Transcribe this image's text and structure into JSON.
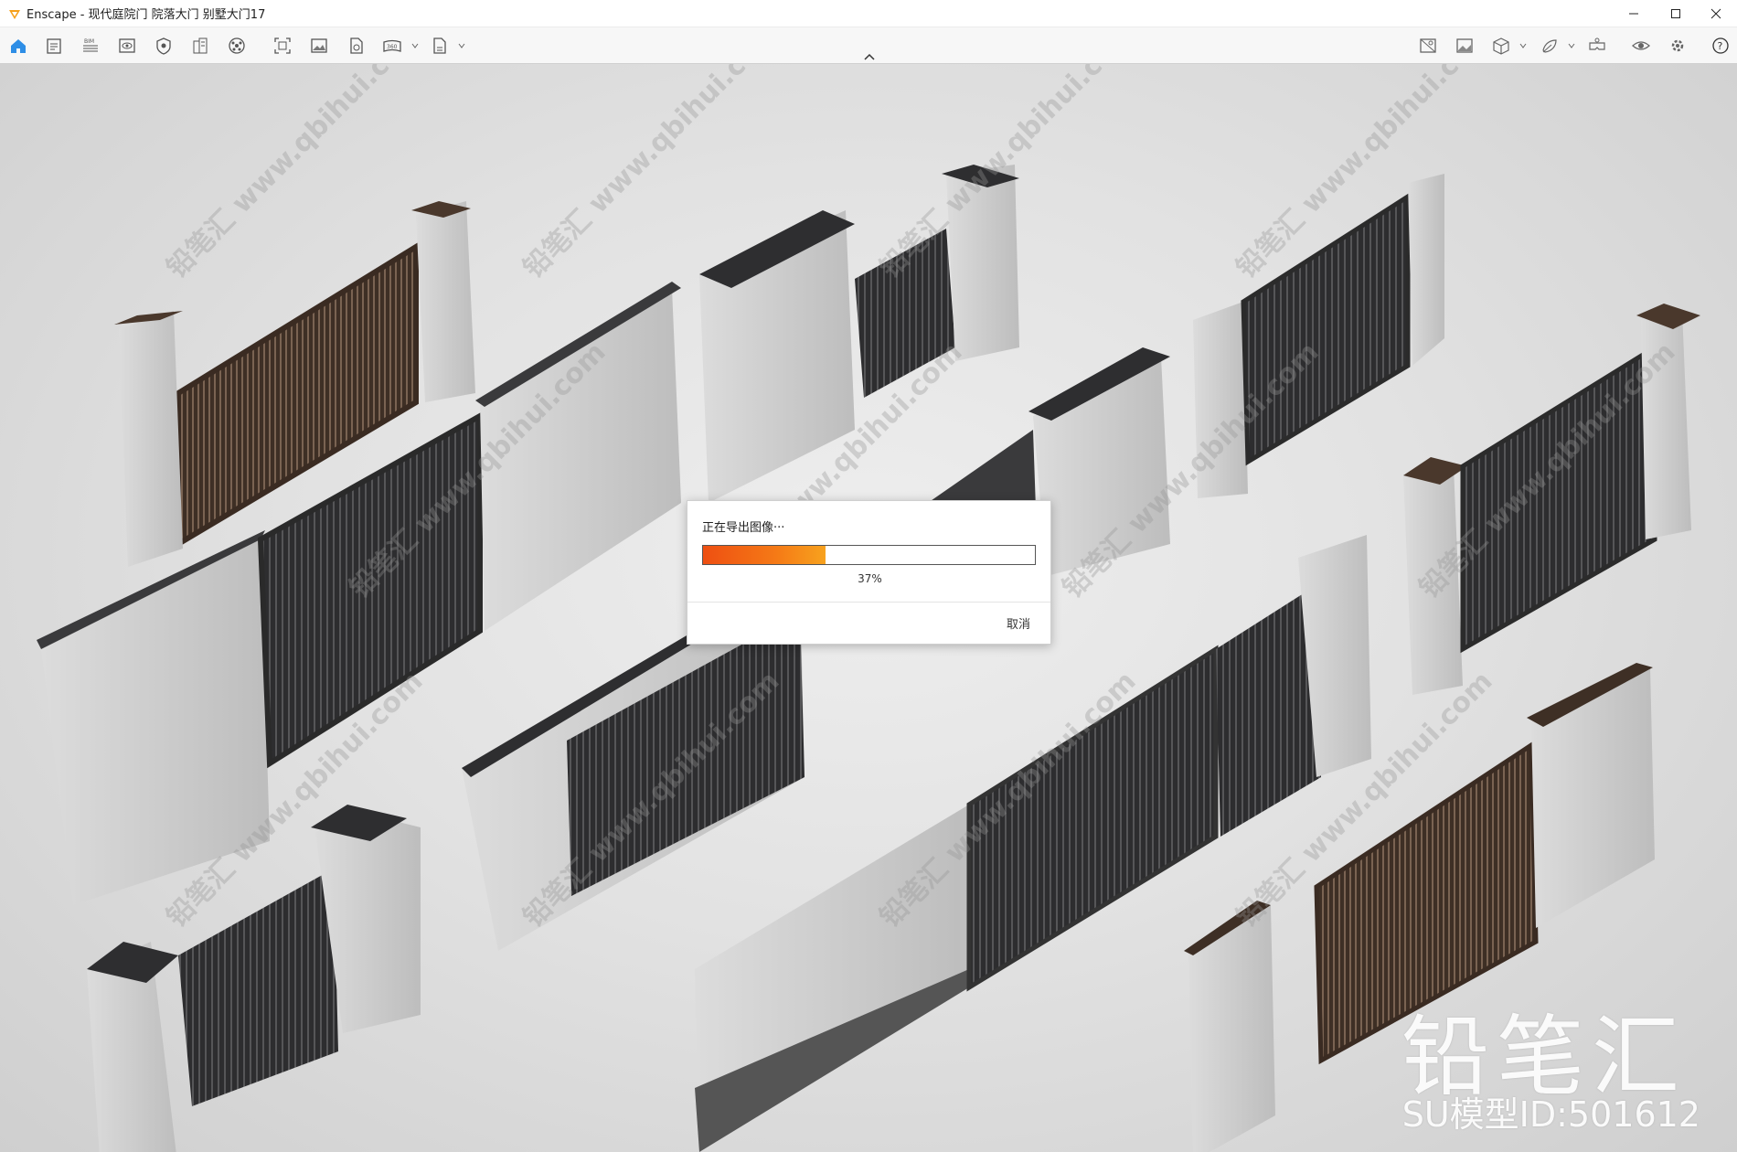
{
  "window": {
    "title": "Enscape - 现代庭院门 院落大门 别墅大门17",
    "icons": {
      "app": "enscape-logo-icon",
      "minimize": "minimize-icon",
      "maximize": "maximize-icon",
      "close": "close-icon"
    }
  },
  "toolbar": {
    "left_icons": [
      "home-icon",
      "notes-icon",
      "bim-icon",
      "visual-settings-icon",
      "atmosphere-icon",
      "asset-library-icon",
      "materials-icon",
      "screenshot-icon",
      "image-icon",
      "batch-render-icon",
      "panorama-icon",
      "export-icon"
    ],
    "right_icons": [
      "view-management-icon",
      "render-image-icon",
      "cube-icon",
      "capture-icon",
      "vr-headset-icon",
      "visibility-icon",
      "settings-icon",
      "help-icon"
    ],
    "bim_label": "BIM",
    "panorama_label": "360"
  },
  "dialog": {
    "title": "正在导出图像···",
    "progress": 0.37,
    "percent_text": "37%",
    "cancel_label": "取消"
  },
  "overlay": {
    "watermark_text": "铅笔汇 www.qbihui.com",
    "brand": "铅笔汇",
    "model_id": "SU模型ID:501612"
  },
  "colors": {
    "progress_start": "#ee4f12",
    "progress_end": "#f7a21e",
    "active_icon": "#2e8ee6"
  }
}
